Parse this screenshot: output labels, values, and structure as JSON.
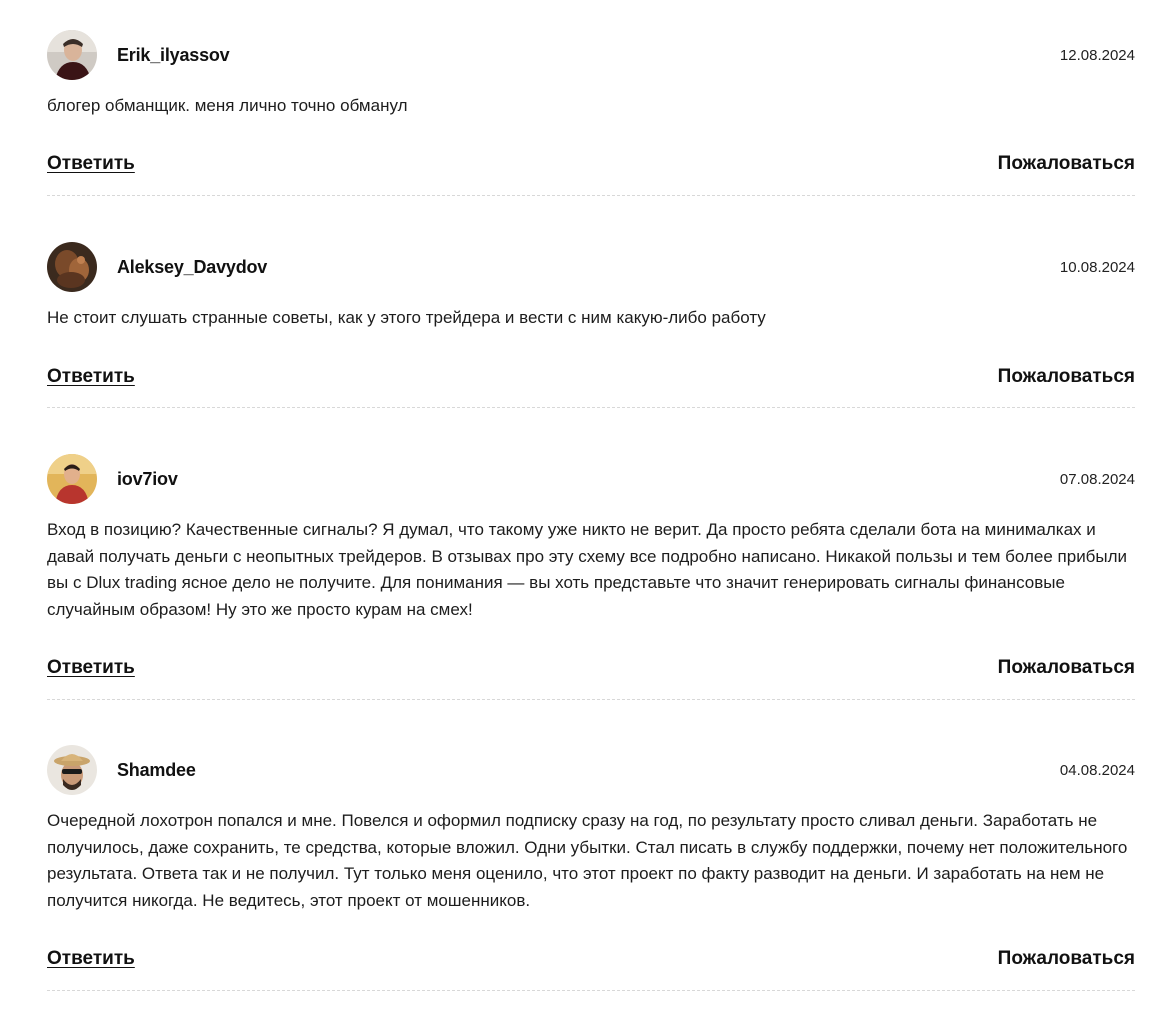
{
  "comments": [
    {
      "author": "Erik_ilyassov",
      "date": "12.08.2024",
      "text": "блогер обманщик. меня лично точно обманул",
      "reply_label": "Ответить",
      "report_label": "Пожаловаться",
      "avatar_icon": "user-avatar-photo"
    },
    {
      "author": "Aleksey_Davydov",
      "date": "10.08.2024",
      "text": "Не стоит слушать странные советы, как у этого трейдера и вести с ним какую-либо работу",
      "reply_label": "Ответить",
      "report_label": "Пожаловаться",
      "avatar_icon": "user-avatar-photo"
    },
    {
      "author": "iov7iov",
      "date": "07.08.2024",
      "text": "Вход в позицию? Качественные сигналы? Я думал, что такому уже никто не верит. Да просто ребята сделали бота на минималках и давай получать деньги с неопытных трейдеров. В отзывах про эту схему все подробно написано. Никакой пользы и тем более прибыли вы с Dlux trading ясное дело не получите. Для понимания — вы хоть представьте что значит генерировать сигналы финансовые случайным образом! Ну это же просто курам на смех!",
      "reply_label": "Ответить",
      "report_label": "Пожаловаться",
      "avatar_icon": "user-avatar-photo"
    },
    {
      "author": "Shamdee",
      "date": "04.08.2024",
      "text": "Очередной лохотрон попался и мне. Повелся и оформил подписку сразу на год, по результату просто сливал деньги. Заработать не получилось, даже сохранить, те средства, которые вложил. Одни убытки. Стал писать в службу поддержки, почему нет положительного результата. Ответа так и не получил. Тут только меня оценило, что этот проект по факту разводит на деньги. И заработать на нем не получится никогда. Не ведитесь, этот проект от мошенников.",
      "reply_label": "Ответить",
      "report_label": "Пожаловаться",
      "avatar_icon": "user-avatar-photo"
    }
  ]
}
